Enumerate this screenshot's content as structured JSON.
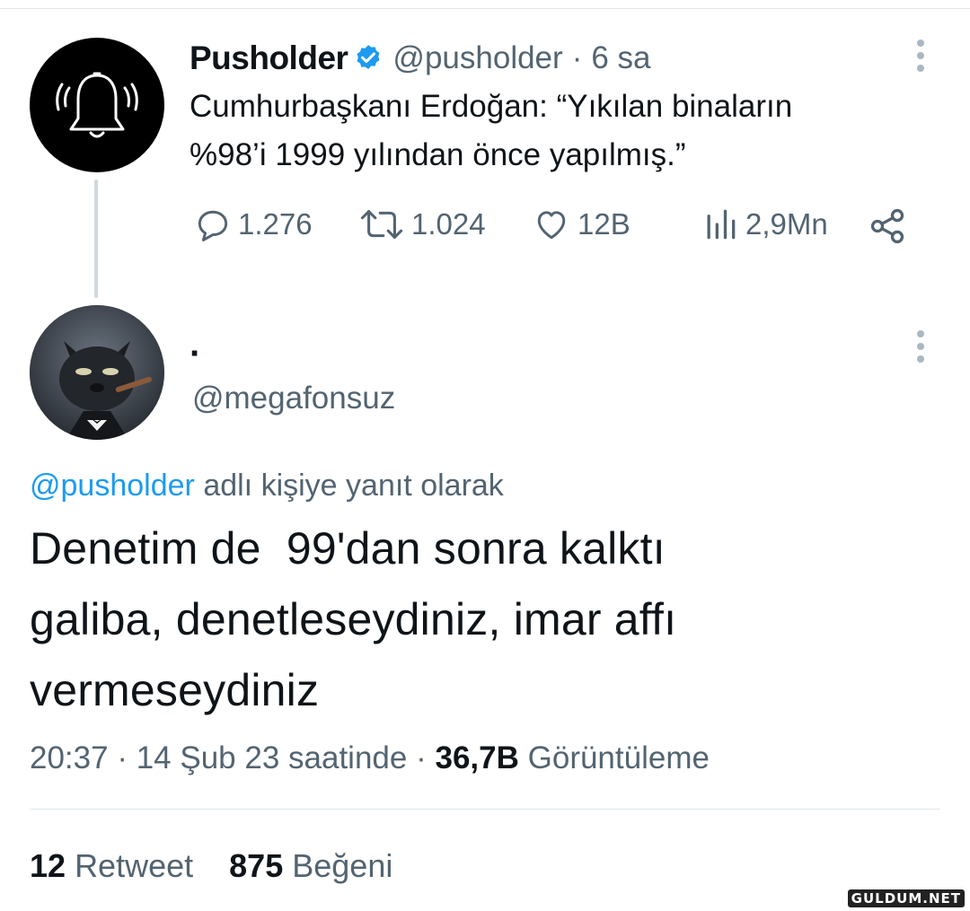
{
  "parent_tweet": {
    "display_name": "Pusholder",
    "handle": "@pusholder",
    "separator": "·",
    "time_ago": "6 sa",
    "text_line1": "Cumhurbaşkanı Erdoğan: “Yıkılan binaların",
    "text_line2": "%98’i 1999 yılından önce yapılmış.”",
    "replies": "1.276",
    "retweets": "1.024",
    "likes": "12B",
    "views": "2,9Mn",
    "avatar_icon": "bell-icon",
    "verified_color": "#1d9bf0"
  },
  "reply_tweet": {
    "display_name": "·",
    "handle": "@megafonsuz",
    "reply_to_handle": "@pusholder",
    "reply_to_suffix": "adlı kişiye yanıt olarak",
    "text_line1": "Denetim de  99'dan sonra kalktı",
    "text_line2": "galiba, denetleseydiniz, imar affı",
    "text_line3": "vermeseydiniz",
    "time": "20:37",
    "date": "14 Şub 23 saatinde",
    "separator": "·",
    "view_count": "36,7B",
    "view_label": "Görüntüleme",
    "retweet_count": "12",
    "retweet_label": "Retweet",
    "like_count": "875",
    "like_label": "Beğeni"
  },
  "watermark": "GULDUM.NET",
  "colors": {
    "link": "#1d9bf0",
    "muted": "#536471",
    "text": "#0f1419"
  }
}
